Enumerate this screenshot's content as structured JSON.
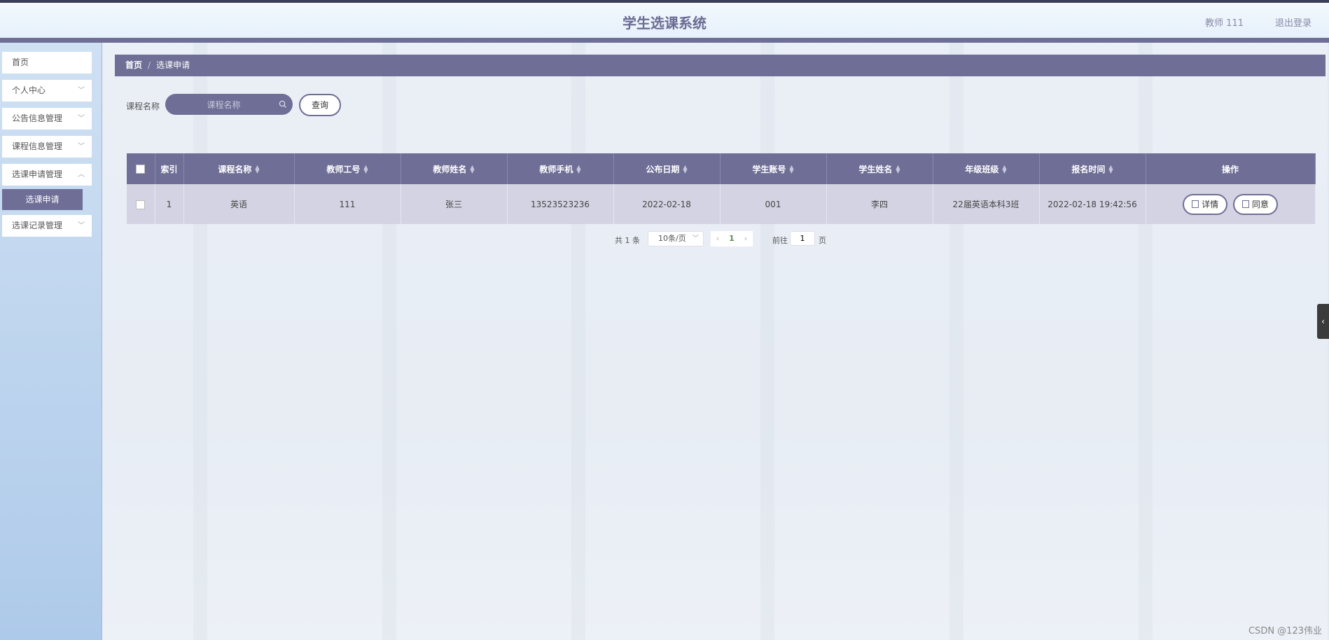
{
  "header": {
    "title": "学生选课系统",
    "user": "教师 111",
    "logout": "退出登录"
  },
  "sidebar": {
    "items": [
      {
        "label": "首页"
      },
      {
        "label": "个人中心"
      },
      {
        "label": "公告信息管理"
      },
      {
        "label": "课程信息管理"
      },
      {
        "label": "选课申请管理"
      },
      {
        "label": "选课记录管理"
      }
    ],
    "active_sub": "选课申请"
  },
  "breadcrumb": {
    "home": "首页",
    "separator": "/",
    "current": "选课申请"
  },
  "search": {
    "label": "课程名称",
    "placeholder": "课程名称",
    "button": "查询"
  },
  "table": {
    "columns": [
      "索引",
      "课程名称",
      "教师工号",
      "教师姓名",
      "教师手机",
      "公布日期",
      "学生账号",
      "学生姓名",
      "年级班级",
      "报名时间",
      "操作"
    ],
    "rows": [
      {
        "index": "1",
        "course": "英语",
        "teacher_id": "111",
        "teacher_name": "张三",
        "teacher_phone": "13523523236",
        "publish_date": "2022-02-18",
        "student_account": "001",
        "student_name": "李四",
        "class": "22届英语本科3班",
        "signup_time": "2022-02-18 19:42:56",
        "detail_btn": "详情",
        "approve_btn": "同意"
      }
    ]
  },
  "pagination": {
    "total": "共 1 条",
    "page_size": "10条/页",
    "current_page": "1",
    "goto_label": "前往",
    "goto_value": "1",
    "page_unit": "页"
  },
  "watermark": "CSDN @123伟业",
  "colors": {
    "accent": "#6e6e96",
    "row_bg": "#d4d3e3"
  }
}
